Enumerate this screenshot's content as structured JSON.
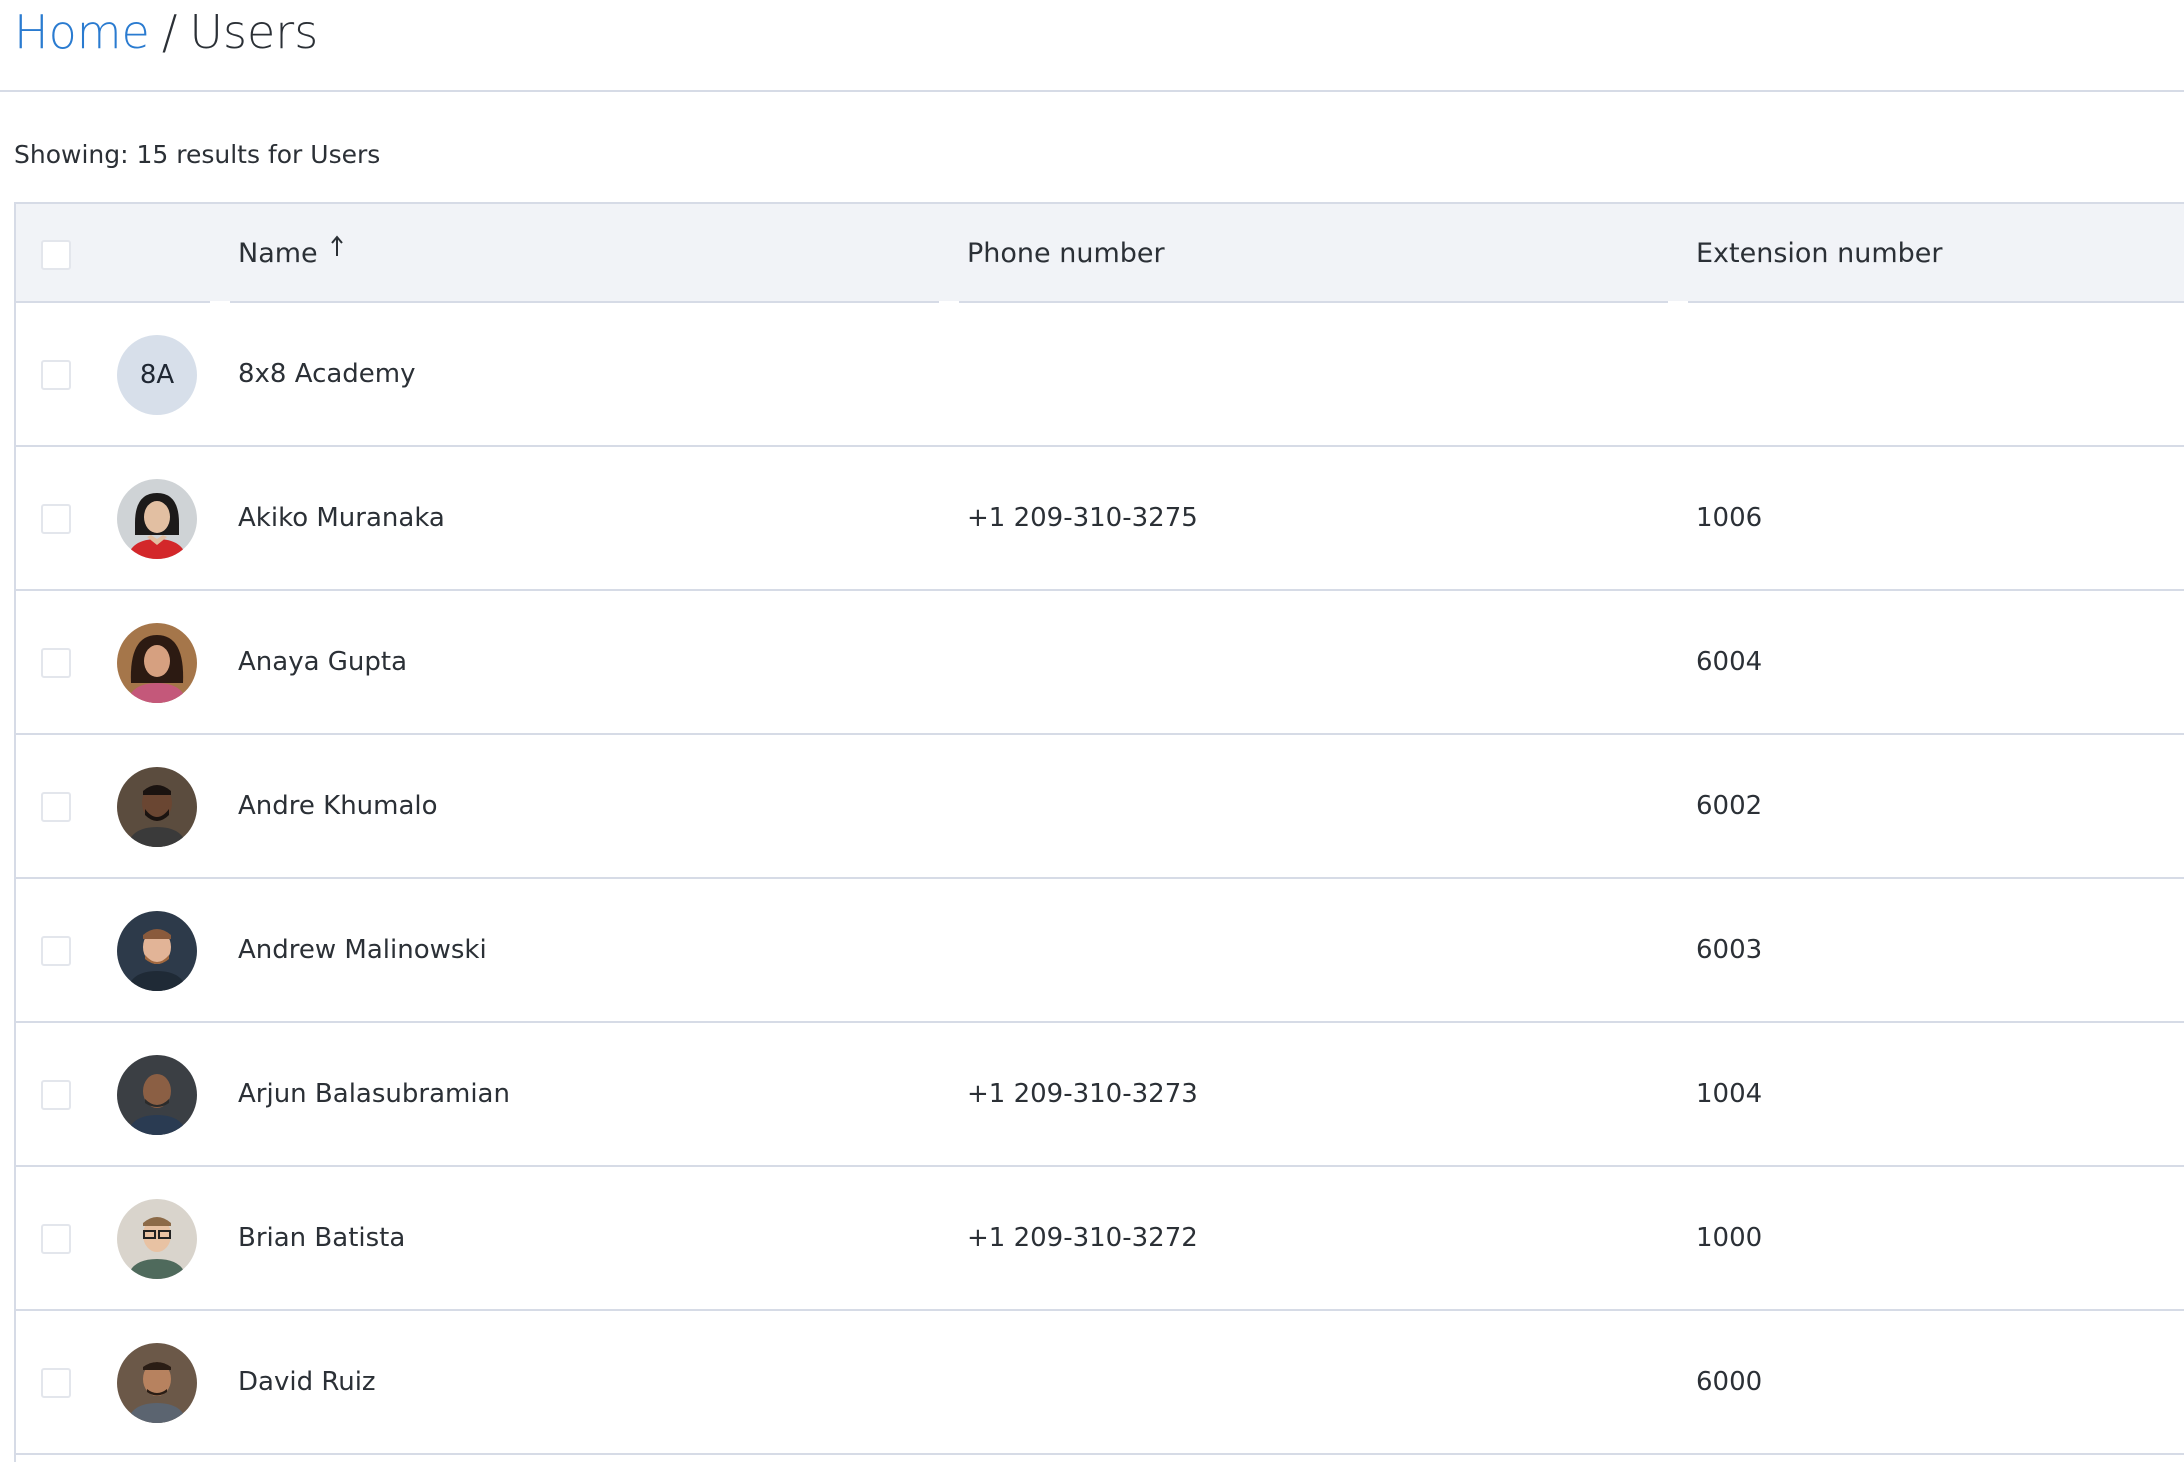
{
  "breadcrumb": {
    "home": "Home",
    "separator": "/",
    "current": "Users"
  },
  "summary": "Showing: 15 results for Users",
  "table": {
    "columns": {
      "name": "Name",
      "phone": "Phone number",
      "extension": "Extension number"
    },
    "sort": {
      "column": "name",
      "direction": "ascending",
      "icon": "arrow-up-icon"
    },
    "rows": [
      {
        "name": "8x8 Academy",
        "initials": "8A",
        "phone": "",
        "extension": ""
      },
      {
        "name": "Akiko Muranaka",
        "phone": "+1 209-310-3275",
        "extension": "1006"
      },
      {
        "name": "Anaya Gupta",
        "phone": "",
        "extension": "6004"
      },
      {
        "name": "Andre Khumalo",
        "phone": "",
        "extension": "6002"
      },
      {
        "name": "Andrew Malinowski",
        "phone": "",
        "extension": "6003"
      },
      {
        "name": "Arjun Balasubramian",
        "phone": "+1 209-310-3273",
        "extension": "1004"
      },
      {
        "name": "Brian Batista",
        "phone": "+1 209-310-3272",
        "extension": "1000"
      },
      {
        "name": "David Ruiz",
        "phone": "",
        "extension": "6000"
      }
    ]
  },
  "colors": {
    "link": "#2a7bd0",
    "header_bg": "#f1f3f7",
    "border": "#d6dbe6",
    "initials_avatar_bg": "#d7dfea"
  }
}
